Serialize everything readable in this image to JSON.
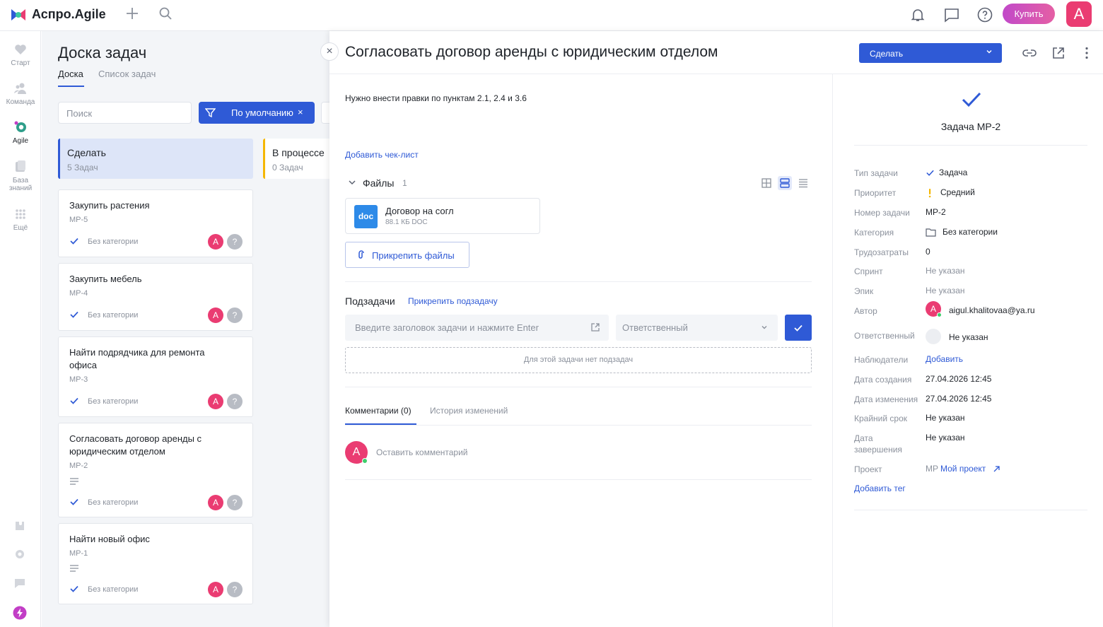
{
  "topbar": {
    "brand": "Аспро.Agile",
    "buy_label": "Купить",
    "avatar_letter": "А"
  },
  "sidebar": {
    "items": [
      {
        "label": "Старт",
        "icon": "heart-icon"
      },
      {
        "label": "Команда",
        "icon": "team-icon"
      },
      {
        "label": "Agile",
        "icon": "agile-icon"
      },
      {
        "label": "База знаний",
        "label_line1": "База",
        "label_line2": "знаний",
        "icon": "book-icon"
      },
      {
        "label": "Ещё",
        "icon": "grid-dots-icon"
      }
    ]
  },
  "board": {
    "title": "Доска задач",
    "tabs": [
      {
        "label": "Доска",
        "active": true
      },
      {
        "label": "Список задач",
        "active": false
      }
    ],
    "search_placeholder": "Поиск",
    "filter_label": "По умолчанию",
    "filter_clear": "×",
    "columns": [
      {
        "name": "Сделать",
        "count": "5 Задач",
        "color": "#2f5ad6"
      },
      {
        "name": "В процессе",
        "count": "0 Задач",
        "color": "#f5b700"
      }
    ],
    "cards": [
      {
        "title": "Закупить растения",
        "key": "MP-5",
        "category": "Без категории",
        "has_desc": false
      },
      {
        "title": "Закупить мебель",
        "key": "MP-4",
        "category": "Без категории",
        "has_desc": false
      },
      {
        "title": "Найти подрядчика для ремонта офиса",
        "title_line1": "Найти подрядчика для ремонта",
        "title_line2": "офиса",
        "key": "MP-3",
        "category": "Без категории",
        "has_desc": false
      },
      {
        "title": "Согласовать договор аренды с юридическим отделом",
        "title_line1": "Согласовать договор аренды с",
        "title_line2": "юридическим отделом",
        "key": "MP-2",
        "category": "Без категории",
        "has_desc": true
      },
      {
        "title": "Найти новый офис",
        "key": "MP-1",
        "category": "Без категории",
        "has_desc": true
      }
    ],
    "avatar_letter": "А",
    "unassigned_letter": "?"
  },
  "panel": {
    "close": "×",
    "title": "Согласовать договор аренды с юридическим отделом",
    "status": "Сделать",
    "description": "Нужно внести правки по пунктам 2.1, 2.4 и 3.6",
    "add_checklist": "Добавить чек-лист",
    "files": {
      "title": "Файлы",
      "count": "1",
      "items": [
        {
          "badge": "doc",
          "name": "Договор на согл",
          "meta": "88.1 КБ DOC"
        }
      ],
      "attach_label": "Прикрепить файлы"
    },
    "subtasks": {
      "title": "Подзадачи",
      "attach_link": "Прикрепить подзадачу",
      "input_placeholder": "Введите заголовок задачи и нажмите Enter",
      "responsible_placeholder": "Ответственный",
      "empty": "Для этой задачи нет подзадач"
    },
    "comments": {
      "tabs": [
        {
          "label": "Комментарии (0)",
          "active": true
        },
        {
          "label": "История изменений",
          "active": false
        }
      ],
      "avatar_letter": "А",
      "leave": "Оставить комментарий"
    }
  },
  "details": {
    "task_id": "Задача MP-2",
    "props": [
      {
        "key": "Тип задачи",
        "value": "Задача"
      },
      {
        "key": "Приоритет",
        "value": "Средний"
      },
      {
        "key": "Номер задачи",
        "value": "MP-2"
      },
      {
        "key": "Категория",
        "value": "Без категории"
      },
      {
        "key": "Трудозатраты",
        "value": "0"
      },
      {
        "key": "Спринт",
        "value": "Не указан"
      },
      {
        "key": "Эпик",
        "value": "Не указан"
      },
      {
        "key": "Автор",
        "value": "aigul.khalitovaa@ya.ru"
      },
      {
        "key": "Ответственный",
        "value": "Не указан"
      },
      {
        "key": "Наблюдатели",
        "value": "Добавить"
      },
      {
        "key": "Дата создания",
        "value": "27.04.2026 12:45"
      },
      {
        "key": "Дата изменения",
        "value": "27.04.2026 12:45"
      },
      {
        "key": "Крайний срок",
        "value": "Не указан"
      },
      {
        "key": "Дата завершения",
        "key_line1": "Дата",
        "key_line2": "завершения",
        "value": "Не указан"
      },
      {
        "key": "Проект",
        "value_prefix": "MP",
        "value": "Мой проект"
      }
    ],
    "add_tag": "Добавить тег"
  },
  "colors": {
    "accent": "#2f5ad6",
    "avatar": "#ea3c72",
    "priority_medium": "#f5b700",
    "buy_gradient_start": "#c149c9",
    "buy_gradient_end": "#e55fa4"
  }
}
